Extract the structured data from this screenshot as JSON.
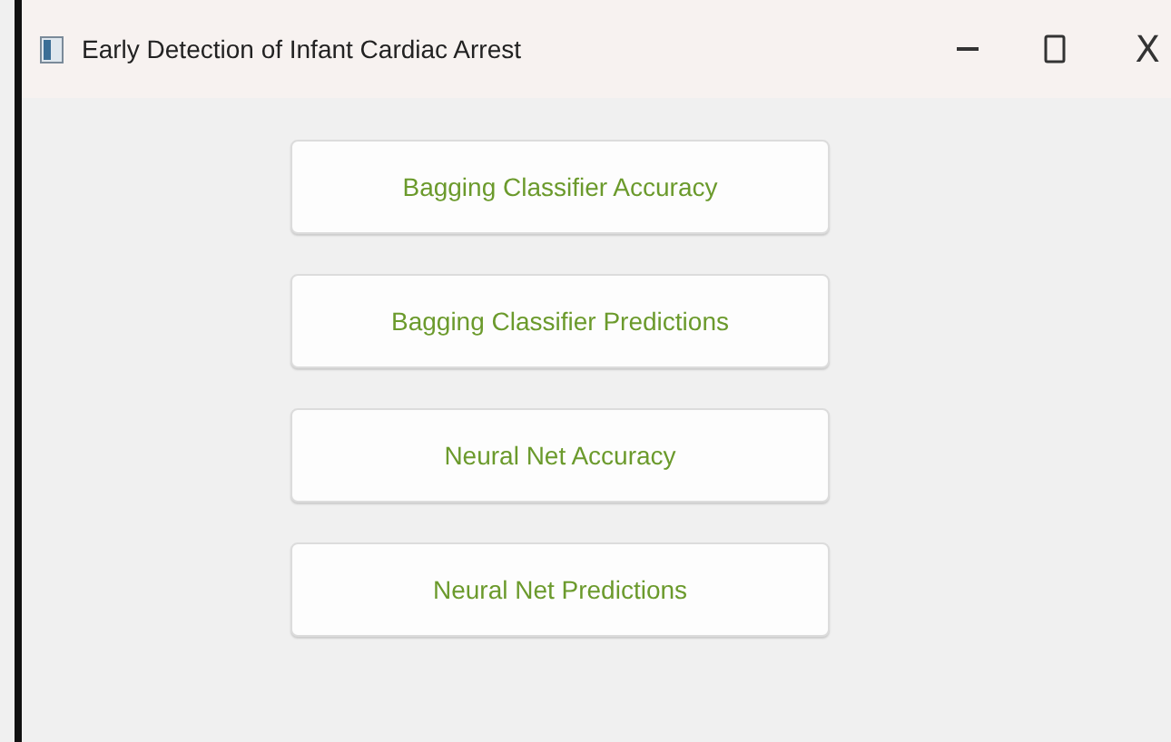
{
  "window": {
    "title": "Early Detection of Infant Cardiac Arrest",
    "close_label": "X"
  },
  "buttons": [
    {
      "label": "Bagging Classifier Accuracy"
    },
    {
      "label": "Bagging Classifier Predictions"
    },
    {
      "label": "Neural Net Accuracy"
    },
    {
      "label": "Neural Net Predictions"
    }
  ]
}
